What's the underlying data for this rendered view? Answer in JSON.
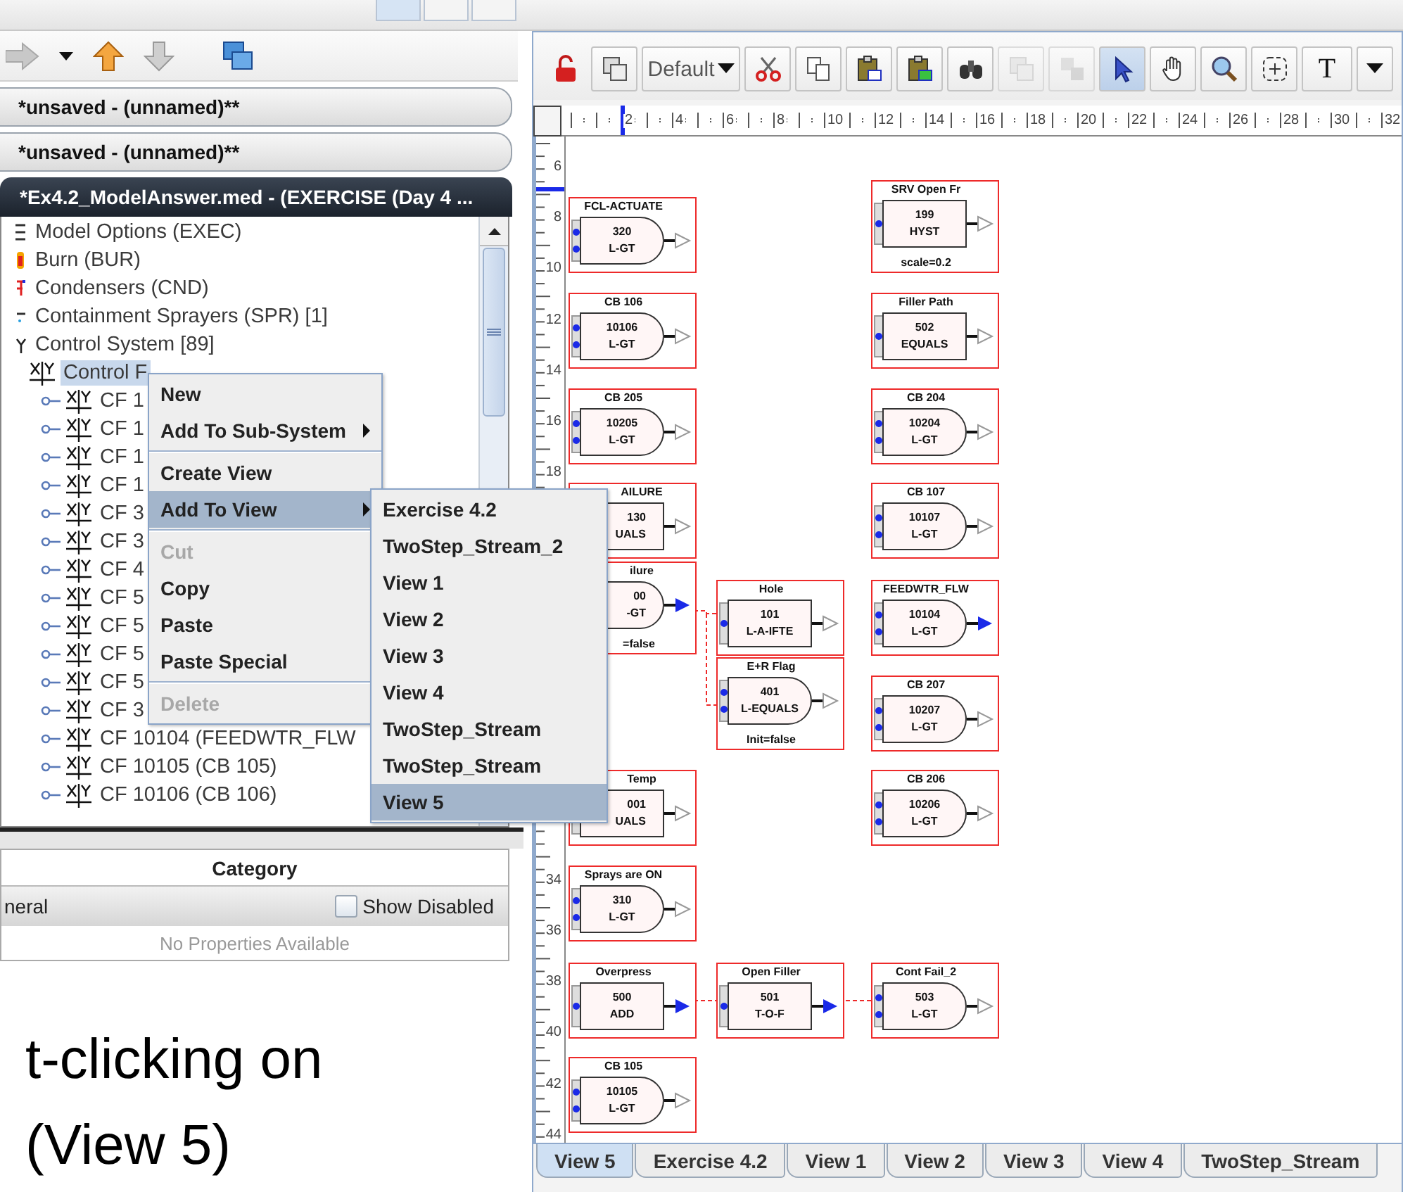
{
  "documents": [
    {
      "title": "*unsaved - (unnamed)**",
      "selected": false
    },
    {
      "title": "*unsaved - (unnamed)**",
      "selected": false
    },
    {
      "title": "*Ex4.2_ModelAnswer.med - (EXERCISE (Day 4 ...",
      "selected": true
    }
  ],
  "tree": {
    "items": [
      {
        "label": "Model Options (EXEC)",
        "kind": "options",
        "selected": false
      },
      {
        "label": "Burn (BUR)",
        "kind": "burn",
        "selected": false
      },
      {
        "label": "Condensers (CND)",
        "kind": "condenser",
        "selected": false
      },
      {
        "label": "Containment Sprayers (SPR) [1]",
        "kind": "sprayer",
        "selected": false
      },
      {
        "label": "Control System [89]",
        "kind": "control",
        "selected": false,
        "children": [
          {
            "label": "Control F",
            "kind": "function",
            "selected": true,
            "children": [
              {
                "label": "CF 1",
                "kind": "function",
                "selected": false
              },
              {
                "label": "CF 1",
                "kind": "function",
                "selected": false
              },
              {
                "label": "CF 1",
                "kind": "function",
                "selected": false
              },
              {
                "label": "CF 1",
                "kind": "function",
                "selected": false
              },
              {
                "label": "CF 3",
                "kind": "function",
                "selected": false
              },
              {
                "label": "CF 3",
                "kind": "function",
                "selected": false
              },
              {
                "label": "CF 4",
                "kind": "function",
                "selected": false
              },
              {
                "label": "CF 5",
                "kind": "function",
                "selected": false
              },
              {
                "label": "CF 5",
                "kind": "function",
                "selected": false
              },
              {
                "label": "CF 5",
                "kind": "function",
                "selected": false
              },
              {
                "label": "CF 5",
                "kind": "function",
                "selected": false
              },
              {
                "label": "CF 3",
                "kind": "function",
                "selected": false
              },
              {
                "label": "CF 10104 (FEEDWTR_FLW",
                "kind": "function",
                "selected": false
              },
              {
                "label": "CF 10105 (CB 105)",
                "kind": "function",
                "selected": false
              },
              {
                "label": "CF 10106 (CB 106)",
                "kind": "function",
                "selected": false
              }
            ]
          }
        ]
      }
    ]
  },
  "context_menu": {
    "items": [
      {
        "kind": "item",
        "label": "New",
        "disabled": false,
        "submenu": false,
        "selected": false
      },
      {
        "kind": "item",
        "label": "Add To Sub-System",
        "disabled": false,
        "submenu": true,
        "selected": false
      },
      {
        "kind": "separator"
      },
      {
        "kind": "item",
        "label": "Create View",
        "disabled": false,
        "submenu": false,
        "selected": false
      },
      {
        "kind": "item",
        "label": "Add To View",
        "disabled": false,
        "submenu": true,
        "selected": true
      },
      {
        "kind": "separator"
      },
      {
        "kind": "item",
        "label": "Cut",
        "disabled": true,
        "submenu": false,
        "selected": false
      },
      {
        "kind": "item",
        "label": "Copy",
        "disabled": false,
        "submenu": false,
        "selected": false
      },
      {
        "kind": "item",
        "label": "Paste",
        "disabled": false,
        "submenu": false,
        "selected": false
      },
      {
        "kind": "item",
        "label": "Paste Special",
        "disabled": false,
        "submenu": false,
        "selected": false
      },
      {
        "kind": "separator"
      },
      {
        "kind": "item",
        "label": "Delete",
        "disabled": true,
        "submenu": false,
        "selected": false
      }
    ]
  },
  "submenu": {
    "items": [
      {
        "label": "Exercise 4.2",
        "selected": false
      },
      {
        "label": "TwoStep_Stream_2",
        "selected": false
      },
      {
        "label": "View 1",
        "selected": false
      },
      {
        "label": "View 2",
        "selected": false
      },
      {
        "label": "View 3",
        "selected": false
      },
      {
        "label": "View 4",
        "selected": false
      },
      {
        "label": "TwoStep_Stream",
        "selected": false
      },
      {
        "label": "TwoStep_Stream",
        "selected": false
      },
      {
        "label": "View 5",
        "selected": true
      }
    ]
  },
  "properties": {
    "header": "Category",
    "group": "neral",
    "show_disabled": {
      "label": "Show Disabled",
      "checked": false
    },
    "empty_text": "No Properties Available"
  },
  "slide_text": [
    "t-clicking on",
    "(View 5)"
  ],
  "diagram": {
    "tools": [
      {
        "kind": "lock",
        "disabled": false,
        "selected": false
      },
      {
        "kind": "layers",
        "disabled": false,
        "selected": false
      },
      {
        "kind": "dropdown",
        "label": "Default",
        "disabled": false,
        "selected": false
      },
      {
        "kind": "cut",
        "disabled": false,
        "selected": false
      },
      {
        "kind": "copy",
        "disabled": false,
        "selected": false
      },
      {
        "kind": "paste",
        "disabled": false,
        "selected": false
      },
      {
        "kind": "paste-special",
        "disabled": false,
        "selected": false
      },
      {
        "kind": "find",
        "disabled": false,
        "selected": false
      },
      {
        "kind": "group",
        "disabled": true,
        "selected": false
      },
      {
        "kind": "ungroup",
        "disabled": true,
        "selected": false
      },
      {
        "kind": "pointer",
        "disabled": false,
        "selected": true
      },
      {
        "kind": "pan",
        "disabled": false,
        "selected": false
      },
      {
        "kind": "zoom",
        "disabled": false,
        "selected": false
      },
      {
        "kind": "marquee",
        "disabled": false,
        "selected": false
      },
      {
        "kind": "text",
        "label": "T",
        "disabled": false,
        "selected": false
      },
      {
        "kind": "more",
        "disabled": false,
        "selected": false
      }
    ],
    "x_labels": [
      "2",
      "4",
      "6",
      "8",
      "10",
      "12",
      "14",
      "16",
      "18",
      "20",
      "22",
      "24",
      "26",
      "28",
      "30",
      "32"
    ],
    "y_labels": [
      "6",
      "8",
      "10",
      "12",
      "14",
      "16",
      "18",
      "34",
      "36",
      "38",
      "40",
      "42",
      "44"
    ],
    "blocks": [
      {
        "title": "FCL-ACTUATE",
        "number": "320",
        "operator": "L-GT",
        "kind": "gate",
        "output_active": false
      },
      {
        "title": "CB 106",
        "number": "10106",
        "operator": "L-GT",
        "kind": "gate",
        "output_active": false
      },
      {
        "title": "CB 205",
        "number": "10205",
        "operator": "L-GT",
        "kind": "gate",
        "output_active": false
      },
      {
        "title": "AILURE",
        "number": "130",
        "operator": "UALS",
        "kind": "rect",
        "output_active": false
      },
      {
        "title": "ilure",
        "number": "00",
        "operator": "-GT",
        "kind": "gate",
        "output_active": true,
        "footer": "=false"
      },
      {
        "title": "Temp",
        "number": "001",
        "operator": "UALS",
        "kind": "rect",
        "output_active": false
      },
      {
        "title": "Sprays are ON",
        "number": "310",
        "operator": "L-GT",
        "kind": "gate",
        "output_active": false
      },
      {
        "title": "Overpress",
        "number": "500",
        "operator": "ADD",
        "kind": "rect",
        "output_active": true
      },
      {
        "title": "CB 105",
        "number": "10105",
        "operator": "L-GT",
        "kind": "gate",
        "output_active": false
      },
      {
        "title": "Hole",
        "number": "101",
        "operator": "L-A-IFTE",
        "kind": "rect",
        "output_active": false
      },
      {
        "title": "E+R Flag",
        "number": "401",
        "operator": "L-EQUALS",
        "kind": "gate",
        "output_active": false,
        "footer": "Init=false"
      },
      {
        "title": "Open Filler",
        "number": "501",
        "operator": "T-O-F",
        "kind": "rect",
        "output_active": true
      },
      {
        "title": "SRV Open Fr",
        "number": "199",
        "operator": "HYST",
        "kind": "rect",
        "output_active": false,
        "footer": "scale=0.2"
      },
      {
        "title": "Filler Path",
        "number": "502",
        "operator": "EQUALS",
        "kind": "rect",
        "output_active": false
      },
      {
        "title": "CB 204",
        "number": "10204",
        "operator": "L-GT",
        "kind": "gate",
        "output_active": false
      },
      {
        "title": "CB 107",
        "number": "10107",
        "operator": "L-GT",
        "kind": "gate",
        "output_active": false
      },
      {
        "title": "FEEDWTR_FLW",
        "number": "10104",
        "operator": "L-GT",
        "kind": "gate",
        "output_active": true
      },
      {
        "title": "CB 207",
        "number": "10207",
        "operator": "L-GT",
        "kind": "gate",
        "output_active": false
      },
      {
        "title": "CB 206",
        "number": "10206",
        "operator": "L-GT",
        "kind": "gate",
        "output_active": false
      },
      {
        "title": "Cont Fail_2",
        "number": "503",
        "operator": "L-GT",
        "kind": "gate",
        "output_active": false
      }
    ],
    "tabs": [
      {
        "label": "View 5",
        "selected": true
      },
      {
        "label": "Exercise 4.2",
        "selected": false
      },
      {
        "label": "View 1",
        "selected": false
      },
      {
        "label": "View 2",
        "selected": false
      },
      {
        "label": "View 3",
        "selected": false
      },
      {
        "label": "View 4",
        "selected": false
      },
      {
        "label": "TwoStep_Stream",
        "selected": false
      }
    ]
  }
}
